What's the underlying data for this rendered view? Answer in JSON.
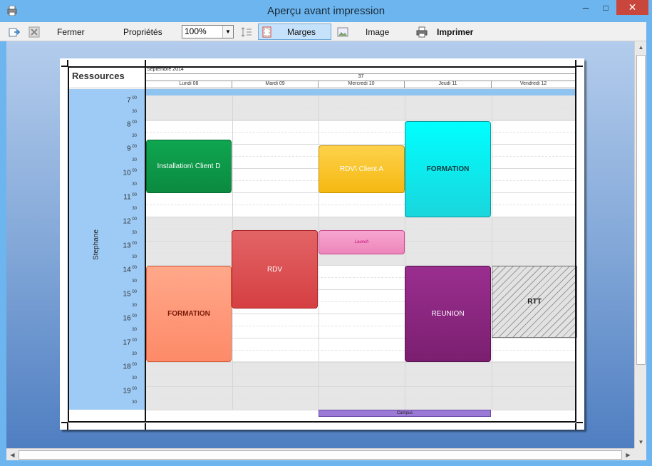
{
  "window": {
    "title": "Aperçu avant impression"
  },
  "toolbar": {
    "fermer": "Fermer",
    "proprietes": "Propriétés",
    "zoom": "100%",
    "marges": "Marges",
    "image": "Image",
    "imprimer": "Imprimer"
  },
  "schedule": {
    "resources_header": "Ressources",
    "resource": "Stephane",
    "month": "Septembre 2014",
    "week": "37",
    "days": [
      "Lundi 08",
      "Mardi 09",
      "Mercredi 10",
      "Jeudi 11",
      "Vendredi 12"
    ],
    "hours": [
      "7",
      "8",
      "9",
      "10",
      "11",
      "12",
      "13",
      "14",
      "15",
      "16",
      "17",
      "18",
      "19"
    ],
    "minutes_top": "00",
    "minutes_half": "30",
    "appointments": [
      {
        "label": "Installation\\ Client D",
        "color": "#0e9a4a"
      },
      {
        "label": "RDV\\ Client A",
        "color": "#f9c01f"
      },
      {
        "label": "FORMATION",
        "color": "#14e4ea"
      },
      {
        "label": "RDV",
        "color": "#dc4e50"
      },
      {
        "label": "Launch",
        "color": "#f08ec0"
      },
      {
        "label": "FORMATION",
        "color": "#ff9a7a"
      },
      {
        "label": "REUNION",
        "color": "#8a2a80"
      },
      {
        "label": "RTT",
        "color": "#d9d9d9"
      }
    ],
    "campus": "Campus"
  }
}
